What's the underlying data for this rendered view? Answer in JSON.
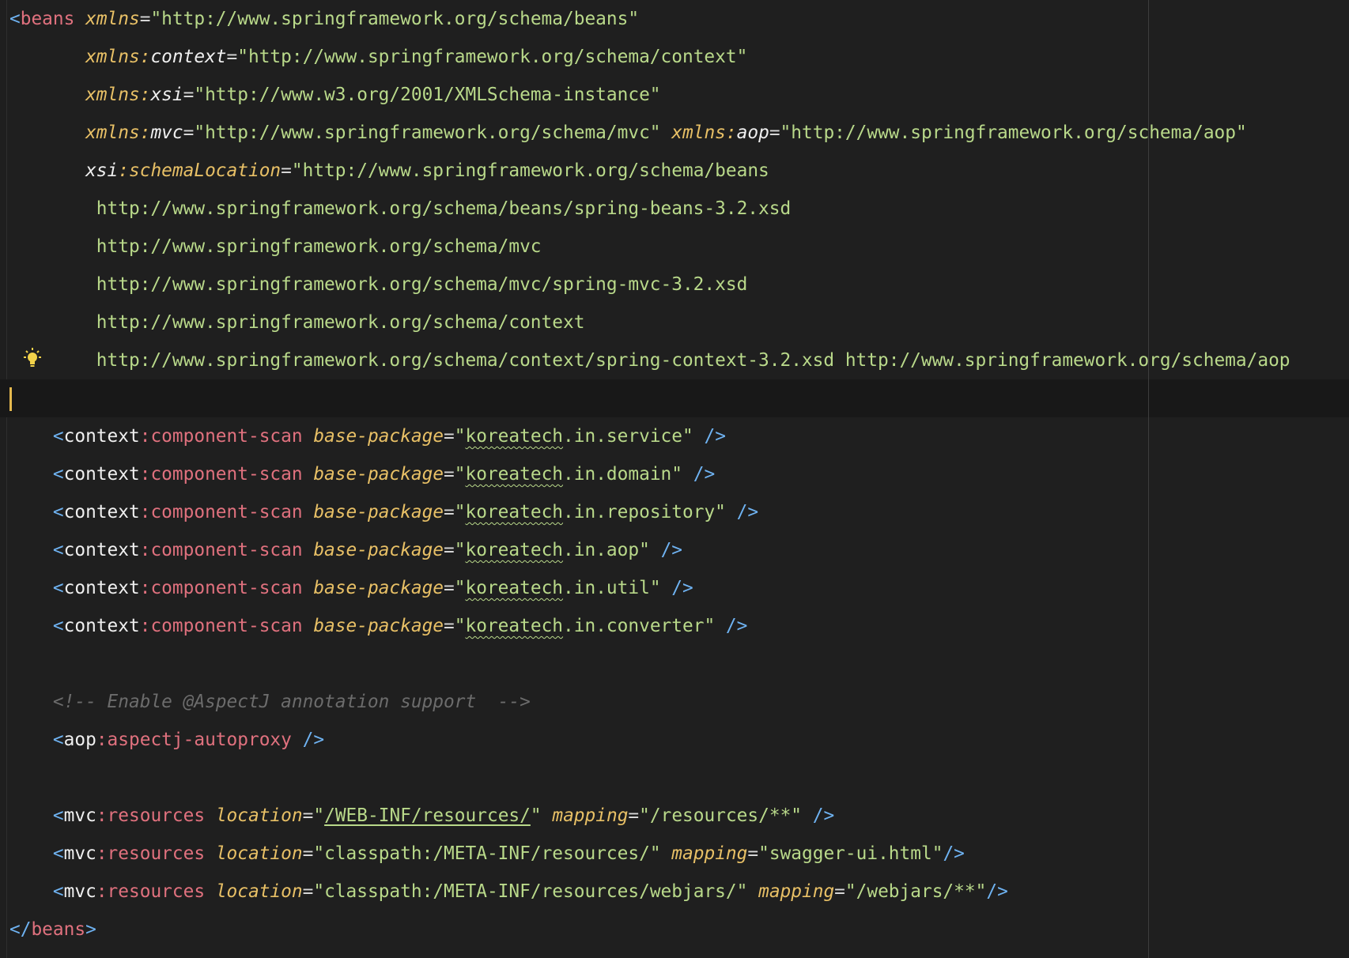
{
  "editor": {
    "lines": [
      [
        [
          "pun",
          "<"
        ],
        [
          "tag",
          "beans"
        ],
        [
          "op",
          " "
        ],
        [
          "attr",
          "xmlns"
        ],
        [
          "op",
          "="
        ],
        [
          "str",
          "\"http://www.springframework.org/schema/beans\""
        ]
      ],
      [
        [
          "op",
          "       "
        ],
        [
          "attr",
          "xmlns:"
        ],
        [
          "nsa",
          "context"
        ],
        [
          "op",
          "="
        ],
        [
          "str",
          "\"http://www.springframework.org/schema/context\""
        ]
      ],
      [
        [
          "op",
          "       "
        ],
        [
          "attr",
          "xmlns:"
        ],
        [
          "nsa",
          "xsi"
        ],
        [
          "op",
          "="
        ],
        [
          "str",
          "\"http://www.w3.org/2001/XMLSchema-instance\""
        ]
      ],
      [
        [
          "op",
          "       "
        ],
        [
          "attr",
          "xmlns:"
        ],
        [
          "nsa",
          "mvc"
        ],
        [
          "op",
          "="
        ],
        [
          "str",
          "\"http://www.springframework.org/schema/mvc\""
        ],
        [
          "op",
          " "
        ],
        [
          "attr",
          "xmlns:"
        ],
        [
          "nsa",
          "aop"
        ],
        [
          "op",
          "="
        ],
        [
          "str",
          "\"http://www.springframework.org/schema/aop\""
        ]
      ],
      [
        [
          "op",
          "       "
        ],
        [
          "nsa",
          "xsi"
        ],
        [
          "attr",
          ":schemaLocation"
        ],
        [
          "op",
          "="
        ],
        [
          "str",
          "\"http://www.springframework.org/schema/beans"
        ]
      ],
      [
        [
          "str",
          "        http://www.springframework.org/schema/beans/spring-beans-3.2.xsd"
        ]
      ],
      [
        [
          "str",
          "        http://www.springframework.org/schema/mvc"
        ]
      ],
      [
        [
          "str",
          "        http://www.springframework.org/schema/mvc/spring-mvc-3.2.xsd"
        ]
      ],
      [
        [
          "str",
          "        http://www.springframework.org/schema/context"
        ]
      ],
      [
        [
          "str",
          "        http://www.springframework.org/schema/context/spring-context-3.2.xsd http://www.springframework.org/schema/aop"
        ]
      ],
      [
        [
          "op",
          ""
        ]
      ],
      [
        [
          "op",
          "    "
        ],
        [
          "pun",
          "<"
        ],
        [
          "ns",
          "context"
        ],
        [
          "tag",
          ":component-scan"
        ],
        [
          "op",
          " "
        ],
        [
          "attr",
          "base-package"
        ],
        [
          "op",
          "="
        ],
        [
          "str",
          "\""
        ],
        [
          "wavy",
          "koreatech"
        ],
        [
          "str",
          ".in.service\""
        ],
        [
          "op",
          " "
        ],
        [
          "pun",
          "/>"
        ]
      ],
      [
        [
          "op",
          "    "
        ],
        [
          "pun",
          "<"
        ],
        [
          "ns",
          "context"
        ],
        [
          "tag",
          ":component-scan"
        ],
        [
          "op",
          " "
        ],
        [
          "attr",
          "base-package"
        ],
        [
          "op",
          "="
        ],
        [
          "str",
          "\""
        ],
        [
          "wavy",
          "koreatech"
        ],
        [
          "str",
          ".in.domain\""
        ],
        [
          "op",
          " "
        ],
        [
          "pun",
          "/>"
        ]
      ],
      [
        [
          "op",
          "    "
        ],
        [
          "pun",
          "<"
        ],
        [
          "ns",
          "context"
        ],
        [
          "tag",
          ":component-scan"
        ],
        [
          "op",
          " "
        ],
        [
          "attr",
          "base-package"
        ],
        [
          "op",
          "="
        ],
        [
          "str",
          "\""
        ],
        [
          "wavy",
          "koreatech"
        ],
        [
          "str",
          ".in.repository\""
        ],
        [
          "op",
          " "
        ],
        [
          "pun",
          "/>"
        ]
      ],
      [
        [
          "op",
          "    "
        ],
        [
          "pun",
          "<"
        ],
        [
          "ns",
          "context"
        ],
        [
          "tag",
          ":component-scan"
        ],
        [
          "op",
          " "
        ],
        [
          "attr",
          "base-package"
        ],
        [
          "op",
          "="
        ],
        [
          "str",
          "\""
        ],
        [
          "wavy",
          "koreatech"
        ],
        [
          "str",
          ".in.aop\""
        ],
        [
          "op",
          " "
        ],
        [
          "pun",
          "/>"
        ]
      ],
      [
        [
          "op",
          "    "
        ],
        [
          "pun",
          "<"
        ],
        [
          "ns",
          "context"
        ],
        [
          "tag",
          ":component-scan"
        ],
        [
          "op",
          " "
        ],
        [
          "attr",
          "base-package"
        ],
        [
          "op",
          "="
        ],
        [
          "str",
          "\""
        ],
        [
          "wavy",
          "koreatech"
        ],
        [
          "str",
          ".in.util\""
        ],
        [
          "op",
          " "
        ],
        [
          "pun",
          "/>"
        ]
      ],
      [
        [
          "op",
          "    "
        ],
        [
          "pun",
          "<"
        ],
        [
          "ns",
          "context"
        ],
        [
          "tag",
          ":component-scan"
        ],
        [
          "op",
          " "
        ],
        [
          "attr",
          "base-package"
        ],
        [
          "op",
          "="
        ],
        [
          "str",
          "\""
        ],
        [
          "wavy",
          "koreatech"
        ],
        [
          "str",
          ".in.converter\""
        ],
        [
          "op",
          " "
        ],
        [
          "pun",
          "/>"
        ]
      ],
      [
        [
          "op",
          ""
        ]
      ],
      [
        [
          "op",
          "    "
        ],
        [
          "cmt",
          "<!-- Enable @AspectJ annotation support  -->"
        ]
      ],
      [
        [
          "op",
          "    "
        ],
        [
          "pun",
          "<"
        ],
        [
          "ns",
          "aop"
        ],
        [
          "tag",
          ":aspectj-autoproxy"
        ],
        [
          "op",
          " "
        ],
        [
          "pun",
          "/>"
        ]
      ],
      [
        [
          "op",
          ""
        ]
      ],
      [
        [
          "op",
          "    "
        ],
        [
          "pun",
          "<"
        ],
        [
          "ns",
          "mvc"
        ],
        [
          "tag",
          ":resources"
        ],
        [
          "op",
          " "
        ],
        [
          "attr",
          "location"
        ],
        [
          "op",
          "="
        ],
        [
          "str",
          "\""
        ],
        [
          "lnk",
          "/WEB-INF/resources/"
        ],
        [
          "str",
          "\""
        ],
        [
          "op",
          " "
        ],
        [
          "attr",
          "mapping"
        ],
        [
          "op",
          "="
        ],
        [
          "str",
          "\"/resources/**\""
        ],
        [
          "op",
          " "
        ],
        [
          "pun",
          "/>"
        ]
      ],
      [
        [
          "op",
          "    "
        ],
        [
          "pun",
          "<"
        ],
        [
          "ns",
          "mvc"
        ],
        [
          "tag",
          ":resources"
        ],
        [
          "op",
          " "
        ],
        [
          "attr",
          "location"
        ],
        [
          "op",
          "="
        ],
        [
          "str",
          "\"classpath:/META-INF/resources/\""
        ],
        [
          "op",
          " "
        ],
        [
          "attr",
          "mapping"
        ],
        [
          "op",
          "="
        ],
        [
          "str",
          "\"swagger-ui.html\""
        ],
        [
          "pun",
          "/>"
        ]
      ],
      [
        [
          "op",
          "    "
        ],
        [
          "pun",
          "<"
        ],
        [
          "ns",
          "mvc"
        ],
        [
          "tag",
          ":resources"
        ],
        [
          "op",
          " "
        ],
        [
          "attr",
          "location"
        ],
        [
          "op",
          "="
        ],
        [
          "str",
          "\"classpath:/META-INF/resources/webjars/\""
        ],
        [
          "op",
          " "
        ],
        [
          "attr",
          "mapping"
        ],
        [
          "op",
          "="
        ],
        [
          "str",
          "\"/webjars/**\""
        ],
        [
          "pun",
          "/>"
        ]
      ],
      [
        [
          "pun",
          "</"
        ],
        [
          "tag",
          "beans"
        ],
        [
          "pun",
          ">"
        ]
      ]
    ]
  }
}
